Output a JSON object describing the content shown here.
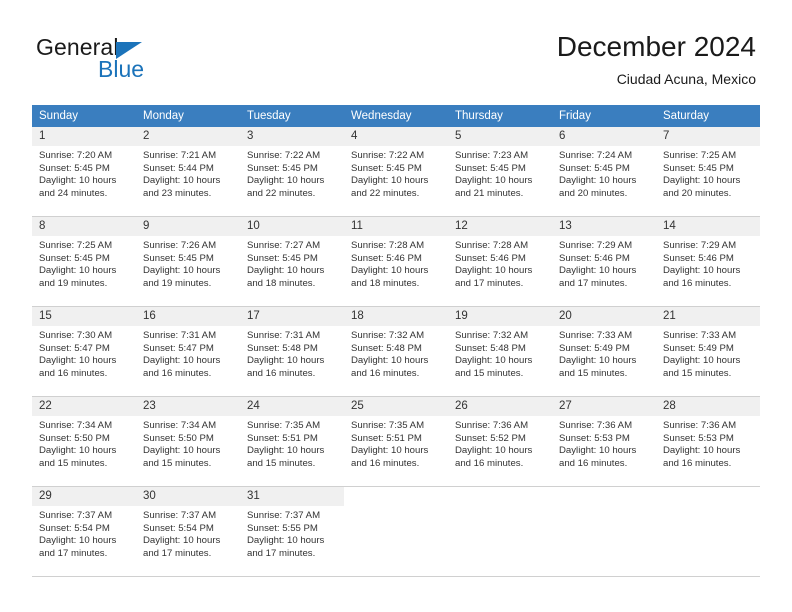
{
  "brand": {
    "word_one": "General",
    "word_two": "Blue",
    "triangle_icon": "brand-triangle-icon",
    "accent_color": "#1b73ba"
  },
  "header": {
    "title": "December 2024",
    "subtitle": "Ciudad Acuna, Mexico"
  },
  "calendar": {
    "header_bg": "#3a7ebf",
    "daynum_bg": "#f0f0f0",
    "weekdays": [
      "Sunday",
      "Monday",
      "Tuesday",
      "Wednesday",
      "Thursday",
      "Friday",
      "Saturday"
    ],
    "weeks": [
      [
        {
          "day": "1",
          "sunrise": "Sunrise: 7:20 AM",
          "sunset": "Sunset: 5:45 PM",
          "daylight_line1": "Daylight: 10 hours",
          "daylight_line2": "and 24 minutes."
        },
        {
          "day": "2",
          "sunrise": "Sunrise: 7:21 AM",
          "sunset": "Sunset: 5:44 PM",
          "daylight_line1": "Daylight: 10 hours",
          "daylight_line2": "and 23 minutes."
        },
        {
          "day": "3",
          "sunrise": "Sunrise: 7:22 AM",
          "sunset": "Sunset: 5:45 PM",
          "daylight_line1": "Daylight: 10 hours",
          "daylight_line2": "and 22 minutes."
        },
        {
          "day": "4",
          "sunrise": "Sunrise: 7:22 AM",
          "sunset": "Sunset: 5:45 PM",
          "daylight_line1": "Daylight: 10 hours",
          "daylight_line2": "and 22 minutes."
        },
        {
          "day": "5",
          "sunrise": "Sunrise: 7:23 AM",
          "sunset": "Sunset: 5:45 PM",
          "daylight_line1": "Daylight: 10 hours",
          "daylight_line2": "and 21 minutes."
        },
        {
          "day": "6",
          "sunrise": "Sunrise: 7:24 AM",
          "sunset": "Sunset: 5:45 PM",
          "daylight_line1": "Daylight: 10 hours",
          "daylight_line2": "and 20 minutes."
        },
        {
          "day": "7",
          "sunrise": "Sunrise: 7:25 AM",
          "sunset": "Sunset: 5:45 PM",
          "daylight_line1": "Daylight: 10 hours",
          "daylight_line2": "and 20 minutes."
        }
      ],
      [
        {
          "day": "8",
          "sunrise": "Sunrise: 7:25 AM",
          "sunset": "Sunset: 5:45 PM",
          "daylight_line1": "Daylight: 10 hours",
          "daylight_line2": "and 19 minutes."
        },
        {
          "day": "9",
          "sunrise": "Sunrise: 7:26 AM",
          "sunset": "Sunset: 5:45 PM",
          "daylight_line1": "Daylight: 10 hours",
          "daylight_line2": "and 19 minutes."
        },
        {
          "day": "10",
          "sunrise": "Sunrise: 7:27 AM",
          "sunset": "Sunset: 5:45 PM",
          "daylight_line1": "Daylight: 10 hours",
          "daylight_line2": "and 18 minutes."
        },
        {
          "day": "11",
          "sunrise": "Sunrise: 7:28 AM",
          "sunset": "Sunset: 5:46 PM",
          "daylight_line1": "Daylight: 10 hours",
          "daylight_line2": "and 18 minutes."
        },
        {
          "day": "12",
          "sunrise": "Sunrise: 7:28 AM",
          "sunset": "Sunset: 5:46 PM",
          "daylight_line1": "Daylight: 10 hours",
          "daylight_line2": "and 17 minutes."
        },
        {
          "day": "13",
          "sunrise": "Sunrise: 7:29 AM",
          "sunset": "Sunset: 5:46 PM",
          "daylight_line1": "Daylight: 10 hours",
          "daylight_line2": "and 17 minutes."
        },
        {
          "day": "14",
          "sunrise": "Sunrise: 7:29 AM",
          "sunset": "Sunset: 5:46 PM",
          "daylight_line1": "Daylight: 10 hours",
          "daylight_line2": "and 16 minutes."
        }
      ],
      [
        {
          "day": "15",
          "sunrise": "Sunrise: 7:30 AM",
          "sunset": "Sunset: 5:47 PM",
          "daylight_line1": "Daylight: 10 hours",
          "daylight_line2": "and 16 minutes."
        },
        {
          "day": "16",
          "sunrise": "Sunrise: 7:31 AM",
          "sunset": "Sunset: 5:47 PM",
          "daylight_line1": "Daylight: 10 hours",
          "daylight_line2": "and 16 minutes."
        },
        {
          "day": "17",
          "sunrise": "Sunrise: 7:31 AM",
          "sunset": "Sunset: 5:48 PM",
          "daylight_line1": "Daylight: 10 hours",
          "daylight_line2": "and 16 minutes."
        },
        {
          "day": "18",
          "sunrise": "Sunrise: 7:32 AM",
          "sunset": "Sunset: 5:48 PM",
          "daylight_line1": "Daylight: 10 hours",
          "daylight_line2": "and 16 minutes."
        },
        {
          "day": "19",
          "sunrise": "Sunrise: 7:32 AM",
          "sunset": "Sunset: 5:48 PM",
          "daylight_line1": "Daylight: 10 hours",
          "daylight_line2": "and 15 minutes."
        },
        {
          "day": "20",
          "sunrise": "Sunrise: 7:33 AM",
          "sunset": "Sunset: 5:49 PM",
          "daylight_line1": "Daylight: 10 hours",
          "daylight_line2": "and 15 minutes."
        },
        {
          "day": "21",
          "sunrise": "Sunrise: 7:33 AM",
          "sunset": "Sunset: 5:49 PM",
          "daylight_line1": "Daylight: 10 hours",
          "daylight_line2": "and 15 minutes."
        }
      ],
      [
        {
          "day": "22",
          "sunrise": "Sunrise: 7:34 AM",
          "sunset": "Sunset: 5:50 PM",
          "daylight_line1": "Daylight: 10 hours",
          "daylight_line2": "and 15 minutes."
        },
        {
          "day": "23",
          "sunrise": "Sunrise: 7:34 AM",
          "sunset": "Sunset: 5:50 PM",
          "daylight_line1": "Daylight: 10 hours",
          "daylight_line2": "and 15 minutes."
        },
        {
          "day": "24",
          "sunrise": "Sunrise: 7:35 AM",
          "sunset": "Sunset: 5:51 PM",
          "daylight_line1": "Daylight: 10 hours",
          "daylight_line2": "and 15 minutes."
        },
        {
          "day": "25",
          "sunrise": "Sunrise: 7:35 AM",
          "sunset": "Sunset: 5:51 PM",
          "daylight_line1": "Daylight: 10 hours",
          "daylight_line2": "and 16 minutes."
        },
        {
          "day": "26",
          "sunrise": "Sunrise: 7:36 AM",
          "sunset": "Sunset: 5:52 PM",
          "daylight_line1": "Daylight: 10 hours",
          "daylight_line2": "and 16 minutes."
        },
        {
          "day": "27",
          "sunrise": "Sunrise: 7:36 AM",
          "sunset": "Sunset: 5:53 PM",
          "daylight_line1": "Daylight: 10 hours",
          "daylight_line2": "and 16 minutes."
        },
        {
          "day": "28",
          "sunrise": "Sunrise: 7:36 AM",
          "sunset": "Sunset: 5:53 PM",
          "daylight_line1": "Daylight: 10 hours",
          "daylight_line2": "and 16 minutes."
        }
      ],
      [
        {
          "day": "29",
          "sunrise": "Sunrise: 7:37 AM",
          "sunset": "Sunset: 5:54 PM",
          "daylight_line1": "Daylight: 10 hours",
          "daylight_line2": "and 17 minutes."
        },
        {
          "day": "30",
          "sunrise": "Sunrise: 7:37 AM",
          "sunset": "Sunset: 5:54 PM",
          "daylight_line1": "Daylight: 10 hours",
          "daylight_line2": "and 17 minutes."
        },
        {
          "day": "31",
          "sunrise": "Sunrise: 7:37 AM",
          "sunset": "Sunset: 5:55 PM",
          "daylight_line1": "Daylight: 10 hours",
          "daylight_line2": "and 17 minutes."
        },
        {
          "day": "",
          "sunrise": "",
          "sunset": "",
          "daylight_line1": "",
          "daylight_line2": ""
        },
        {
          "day": "",
          "sunrise": "",
          "sunset": "",
          "daylight_line1": "",
          "daylight_line2": ""
        },
        {
          "day": "",
          "sunrise": "",
          "sunset": "",
          "daylight_line1": "",
          "daylight_line2": ""
        },
        {
          "day": "",
          "sunrise": "",
          "sunset": "",
          "daylight_line1": "",
          "daylight_line2": ""
        }
      ]
    ]
  }
}
